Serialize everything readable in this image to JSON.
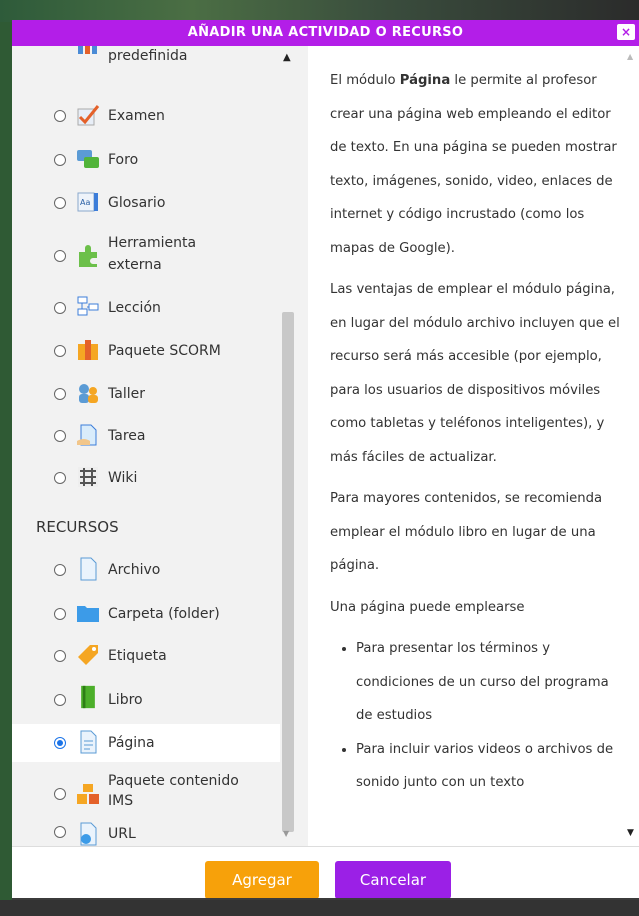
{
  "dialog": {
    "title": "AÑADIR UNA ACTIVIDAD O RECURSO",
    "close_label": "×"
  },
  "activities": [
    {
      "label": "predefinida",
      "icon": "database-icon"
    },
    {
      "label": "Examen",
      "icon": "quiz-icon"
    },
    {
      "label": "Foro",
      "icon": "forum-icon"
    },
    {
      "label": "Glosario",
      "icon": "glossary-icon"
    },
    {
      "label": "Herramienta",
      "label2": "externa",
      "icon": "puzzle-icon"
    },
    {
      "label": "Lección",
      "icon": "lesson-icon"
    },
    {
      "label": "Paquete SCORM",
      "icon": "scorm-icon"
    },
    {
      "label": "Taller",
      "icon": "workshop-icon"
    },
    {
      "label": "Tarea",
      "icon": "assignment-icon"
    },
    {
      "label": "Wiki",
      "icon": "wiki-icon"
    }
  ],
  "resources_heading": "RECURSOS",
  "resources": [
    {
      "label": "Archivo",
      "icon": "file-icon"
    },
    {
      "label": "Carpeta (folder)",
      "icon": "folder-icon"
    },
    {
      "label": "Etiqueta",
      "icon": "tag-icon"
    },
    {
      "label": "Libro",
      "icon": "book-icon"
    },
    {
      "label": "Página",
      "icon": "page-icon",
      "selected": true
    },
    {
      "label": "Paquete contenido",
      "label2": "IMS",
      "icon": "ims-package-icon"
    },
    {
      "label": "URL",
      "icon": "url-icon"
    }
  ],
  "description": {
    "p1_before": "El módulo ",
    "p1_bold": "Página",
    "p1_after": " le permite al profesor crear una página web empleando el editor de texto. En una página se pueden mostrar texto, imágenes, sonido, video, enlaces de internet y código incrustado (como los mapas de Google).",
    "p2": "Las ventajas de emplear el módulo página, en lugar del módulo archivo incluyen que el recurso será más accesible (por ejemplo, para los usuarios de dispositivos móviles como tabletas y teléfonos inteligentes), y más fáciles de actualizar.",
    "p3": "Para mayores contenidos, se recomienda emplear el módulo libro en lugar de una página.",
    "p4": "Una página puede emplearse",
    "bullets": [
      "Para presentar los términos y condiciones de un curso del programa de estudios",
      "Para incluir varios videos o archivos de sonido junto con un texto"
    ]
  },
  "footer": {
    "add_label": "Agregar",
    "cancel_label": "Cancelar"
  },
  "colors": {
    "header": "#b31ee8",
    "add_button": "#f7a10a",
    "cancel_button": "#9b20e6",
    "radio_selected": "#1a73e8"
  }
}
